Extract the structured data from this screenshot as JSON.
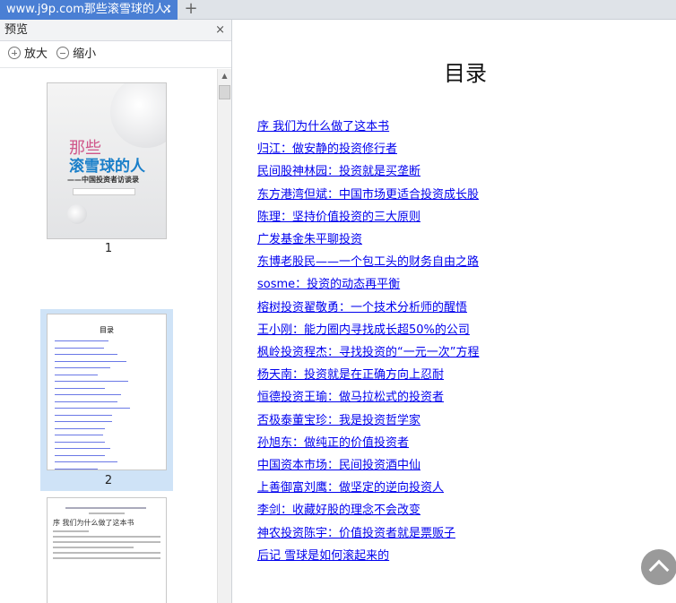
{
  "tab": {
    "title": "www.j9p.com那些滚雪球的人：",
    "close": "×",
    "new_tab": "+"
  },
  "preview": {
    "title": "预览",
    "close": "×",
    "zoom_in": "放大",
    "zoom_out": "缩小",
    "pages": [
      {
        "number": "1",
        "cover_title1": "那些",
        "cover_title2": "滚雪球的人",
        "cover_subtitle": "——中国投资者访谈录"
      },
      {
        "number": "2",
        "heading": "目录"
      },
      {
        "heading": "序 我们为什么做了这本书"
      }
    ]
  },
  "document": {
    "title": "目录",
    "toc": [
      "序 我们为什么做了这本书",
      "归江：做安静的投资修行者",
      "民间股神林园：投资就是买垄断",
      "东方港湾但斌：中国市场更适合投资成长股",
      "陈理：坚持价值投资的三大原则",
      "广发基金朱平聊投资",
      "东博老股民——一个包工头的财务自由之路",
      "sosme：投资的动态再平衡",
      "榕树投资翟敬勇：一个技术分析师的醒悟",
      "王小刚：能力圈内寻找成长超50%的公司",
      "枫岭投资程杰：寻找投资的“一元一次”方程",
      "杨天南：投资就是在正确方向上忍耐",
      "恒德投资王瑜：做马拉松式的投资者",
      "否极泰董宝珍：我是投资哲学家",
      "孙旭东：做纯正的价值投资者",
      "中国资本市场：民间投资酒中仙",
      "上善御富刘鹰：做坚定的逆向投资人",
      "李剑：收藏好股的理念不会改变",
      "神农投资陈宇：价值投资者就是票贩子",
      "后记 雪球是如何滚起来的"
    ]
  },
  "colors": {
    "tab_active": "#4a7fd4",
    "link": "#0000ee",
    "selected_thumb": "#cfe3f7"
  },
  "icons": {
    "zoom_in": "zoom-in-icon",
    "zoom_out": "zoom-out-icon",
    "back_to_top": "chevron-up-icon"
  }
}
